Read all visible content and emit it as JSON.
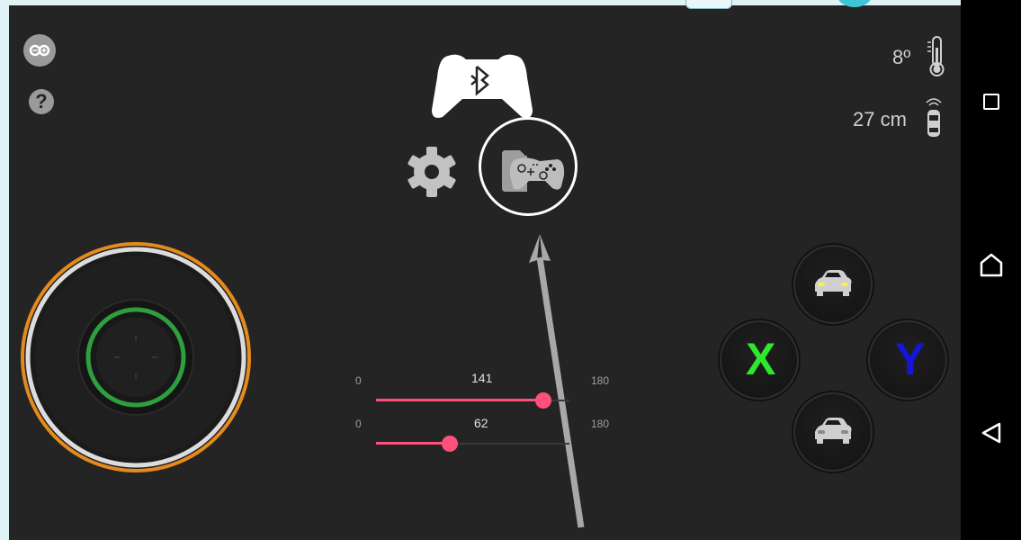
{
  "header": {
    "temperature": "8º",
    "distance": "27 cm"
  },
  "sliders": [
    {
      "min": "0",
      "max": "180",
      "value": "141",
      "fraction": 0.783
    },
    {
      "min": "0",
      "max": "180",
      "value": "62",
      "fraction": 0.344
    }
  ],
  "buttons": {
    "x_label": "X",
    "y_label": "Y"
  },
  "colors": {
    "slider": "#ff4f7b",
    "x_button": "#2ee82e",
    "y_button": "#1515d8",
    "joystick_ring": "#e58a1c",
    "joystick_inner_ring": "#2f9e3f"
  }
}
